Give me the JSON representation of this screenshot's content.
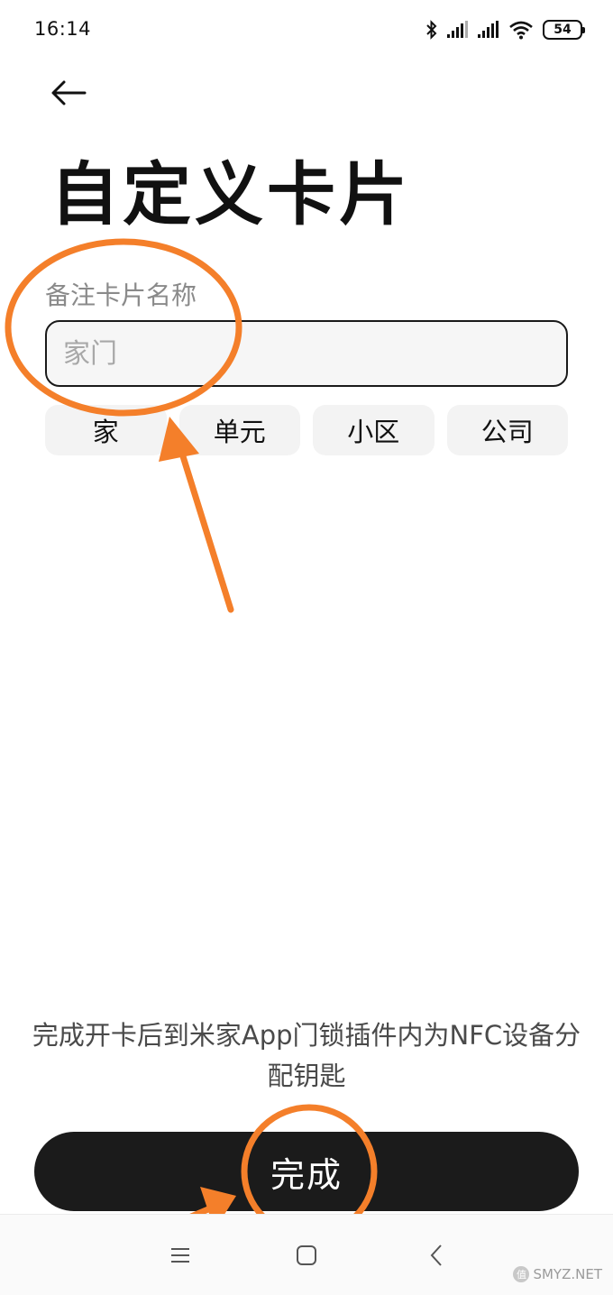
{
  "status_bar": {
    "time": "16:14",
    "battery": "54",
    "icons": [
      "bluetooth-icon",
      "signal-icon",
      "signal-icon",
      "wifi-icon",
      "battery-icon"
    ]
  },
  "header": {
    "back_icon": "arrow-left-icon",
    "title": "自定义卡片"
  },
  "form": {
    "label": "备注卡片名称",
    "input_value": "",
    "input_placeholder": "家门",
    "chips": [
      "家",
      "单元",
      "小区",
      "公司"
    ]
  },
  "footer": {
    "hint": "完成开卡后到米家App门锁插件内为NFC设备分配钥匙",
    "done_label": "完成"
  },
  "nav_bar": {
    "icons": [
      "menu-icon",
      "home-icon",
      "back-icon"
    ]
  },
  "watermark": {
    "badge": "值",
    "text": "SMYZ.NET"
  },
  "colors": {
    "annotation": "#f47f2a",
    "button_bg": "#1b1b1b",
    "chip_bg": "#f3f3f3"
  }
}
